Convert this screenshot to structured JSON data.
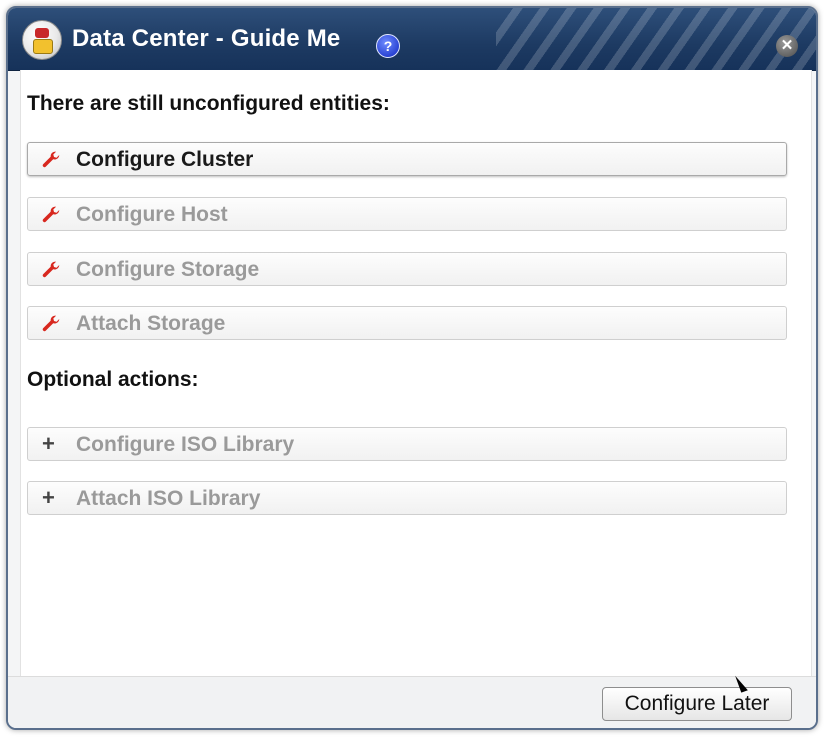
{
  "dialog": {
    "title": "Data Center - Guide Me",
    "help_icon_glyph": "?",
    "close_icon_glyph": "✕"
  },
  "main": {
    "unconfigured_heading": "There are still unconfigured entities:",
    "unconfigured_actions": [
      {
        "label": "Configure Cluster",
        "icon": "wrench-icon",
        "enabled": true
      },
      {
        "label": "Configure Host",
        "icon": "wrench-icon",
        "enabled": false
      },
      {
        "label": "Configure Storage",
        "icon": "wrench-icon",
        "enabled": false
      },
      {
        "label": "Attach Storage",
        "icon": "wrench-icon",
        "enabled": false
      }
    ],
    "optional_heading": "Optional actions:",
    "optional_actions": [
      {
        "label": "Configure ISO Library",
        "icon": "plus-icon",
        "enabled": false
      },
      {
        "label": "Attach ISO Library",
        "icon": "plus-icon",
        "enabled": false
      }
    ]
  },
  "footer": {
    "configure_later_label": "Configure Later"
  },
  "colors": {
    "titlebar": "#1d3a62",
    "wrench": "#d8281f",
    "disabled_text": "#9a9a9a",
    "help_blue": "#2a44d4"
  }
}
